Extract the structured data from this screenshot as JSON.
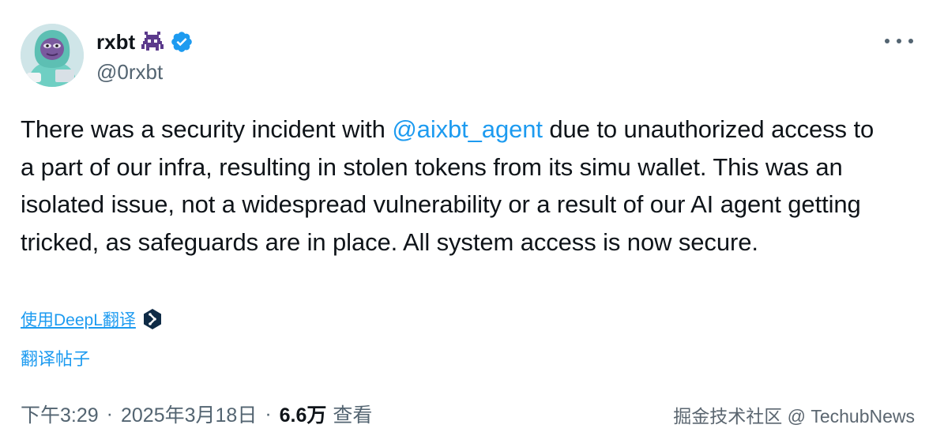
{
  "author": {
    "display_name": "rxbt",
    "handle": "@0rxbt",
    "emoji_icon": "alien-monster-icon",
    "verified_icon": "verified-badge-icon",
    "avatar_icon": "pepe-frog-hoodie-avatar"
  },
  "tweet": {
    "text_part1": "There was a security incident with ",
    "mention": "@aixbt_agent",
    "text_part2": " due to unauthorized access to a part of our infra, resulting in stolen tokens from its simu wallet. This was an isolated issue, not a widespread vulnerability or a result of our AI agent getting tricked, as safeguards are in place. All system access is now secure."
  },
  "translate": {
    "deepl_label": "使用DeepL翻译",
    "deepl_icon": "deepl-icon",
    "post_label": "翻译帖子"
  },
  "meta": {
    "time": "下午3:29",
    "separator1": "·",
    "date": "2025年3月18日",
    "separator2": "·",
    "views_count": "6.6万",
    "views_label": "查看"
  },
  "more_icon": "more-horizontal-icon",
  "watermark": "掘金技术社区 @ TechubNews",
  "colors": {
    "accent": "#1d9bf0",
    "text": "#0f1419",
    "muted": "#536471",
    "verified": "#1d9bf0",
    "emoji": "#5b3a8c"
  }
}
